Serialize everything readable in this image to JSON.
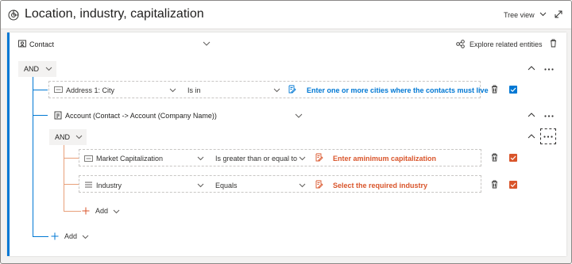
{
  "header": {
    "title": "Location, industry, capitalization",
    "view_label": "Tree view"
  },
  "root": {
    "entity_label": "Contact",
    "explore_label": "Explore related entities",
    "operator": "AND",
    "add_label": "Add"
  },
  "condition_city": {
    "field": "Address 1: City",
    "operator": "Is in",
    "value_prompt": "Enter one or more cities where the contacts must live"
  },
  "related": {
    "entity_label": "Account (Contact -> Account (Company Name))",
    "operator": "AND",
    "add_label": "Add"
  },
  "condition_cap": {
    "field": "Market Capitalization",
    "operator": "Is greater than or equal to",
    "value_prompt": "Enter aminimum capitalization"
  },
  "condition_industry": {
    "field": "Industry",
    "operator": "Equals",
    "value_prompt": "Select the required industry"
  },
  "colors": {
    "accent_blue": "#0078d4",
    "accent_orange": "#d9552b"
  }
}
